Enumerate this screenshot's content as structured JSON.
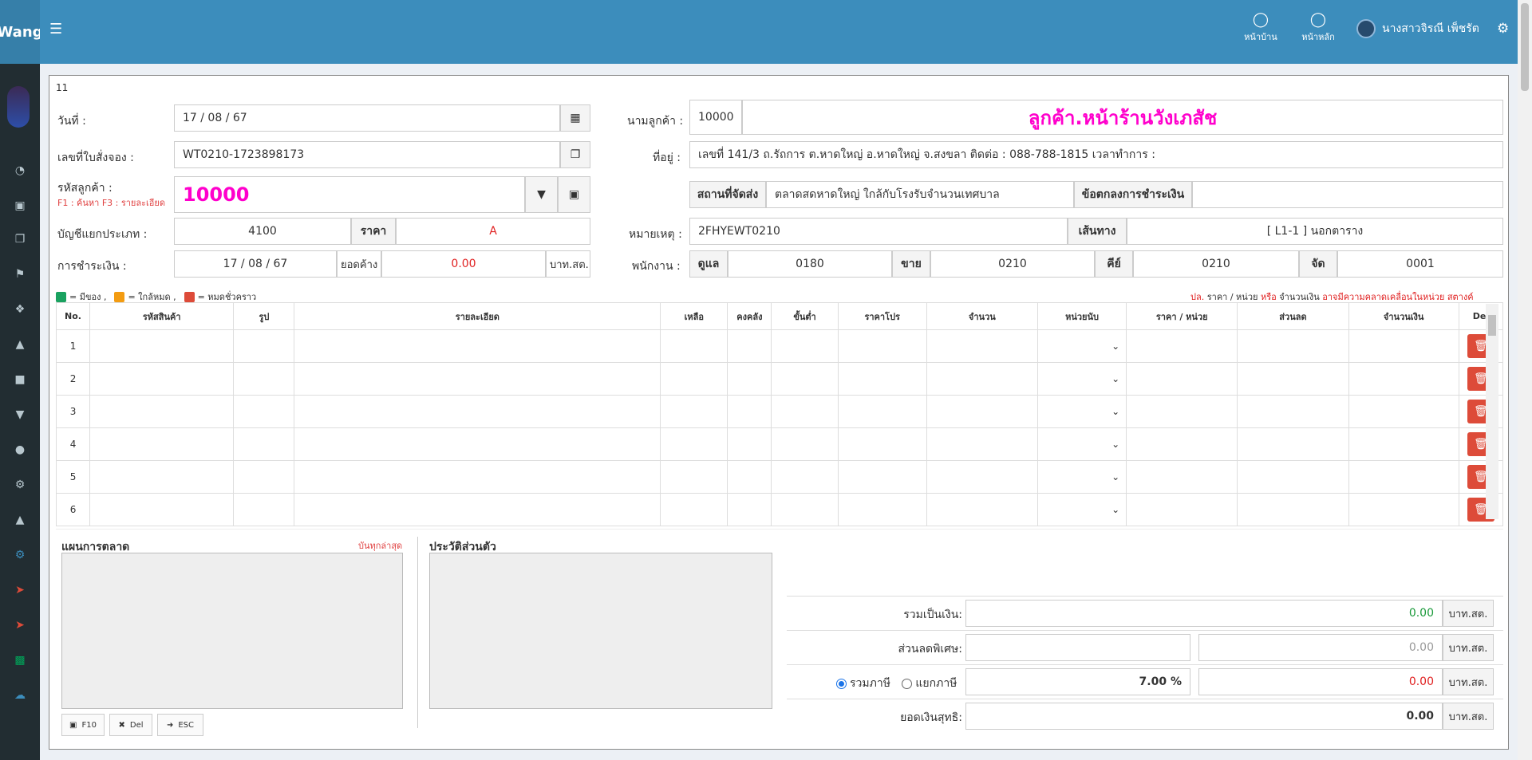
{
  "header": {
    "logo": "Wang",
    "nav": [
      {
        "label": "หน้าบ้าน",
        "icon": "chrome-icon"
      },
      {
        "label": "หน้าหลัก",
        "icon": "chrome-icon"
      }
    ],
    "user_name": "นางสาวจิรณี เพ็ชรัต"
  },
  "sidebar": {
    "icons": [
      "dashboard-icon",
      "money-icon",
      "copy-icon",
      "tag-icon",
      "cubes-icon",
      "car-icon",
      "bag-icon",
      "graduation-icon",
      "user-plus-icon",
      "cog-icon",
      "car-icon",
      "cogs-icon",
      "send-icon",
      "send-icon",
      "file-icon",
      "cloud-upload-icon"
    ]
  },
  "form": {
    "tab_number": "11",
    "date_label": "วันที่  :",
    "date_value": "17 / 08 / 67",
    "order_no_label": "เลขที่ใบสั่งจอง  :",
    "order_no_value": "WT0210-1723898173",
    "customer_code_label": "รหัสลูกค้า  :",
    "customer_code_hint": "F1 : ค้นหา   F3 : รายละเอียด",
    "customer_code_value": "10000",
    "account_label": "บัญชีแยกประเภท  :",
    "account_value": "4100",
    "price_label": "ราคา",
    "price_value": "A",
    "payment_label": "การชำระเงิน  :",
    "payment_date": "17 / 08 / 67",
    "balance_label": "ยอดค้าง",
    "balance_value": "0.00",
    "balance_unit": "บาท.สต.",
    "customer_name_label": "นามลูกค้า  :",
    "customer_id": "10000",
    "customer_name": "ลูกค้า.หน้าร้านวังเภสัช",
    "address_label": "ที่อยู่  :",
    "address_value": "เลขที่ 141/3 ถ.รัถการ ต.หาดใหญ่ อ.หาดใหญ่ จ.สงขลา   ติดต่อ  :  088-788-1815   เวลาทำการ  :",
    "delivery_label": "สถานที่จัดส่ง",
    "delivery_value": "ตลาดสดหาดใหญ่  ใกล้กับโรงรับจำนวนเทศบาล",
    "terms_label": "ข้อตกลงการชำระเงิน",
    "terms_value": "",
    "remark_label": "หมายเหตุ  :",
    "remark_value": "2FHYEWT0210",
    "route_label": "เส้นทาง",
    "route_value": "[   L1-1   ]    นอกตาราง",
    "staff_label": "พนักงาน  :",
    "staff": [
      {
        "label": "ดูแล",
        "value": "0180"
      },
      {
        "label": "ขาย",
        "value": "0210"
      },
      {
        "label": "คีย์",
        "value": "0210"
      },
      {
        "label": "จัด",
        "value": "0001"
      }
    ]
  },
  "legend": {
    "items": [
      {
        "color": "#1aa260",
        "label": "= มีของ  ,"
      },
      {
        "color": "#f39c12",
        "label": "= ใกล้หมด  ,"
      },
      {
        "color": "#dd4b39",
        "label": "= หมดชั่วคราว"
      }
    ],
    "note_1": "ปล.",
    "note_2": "ราคา / หน่วย",
    "note_3": "หรือ",
    "note_4": "จำนวนเงิน",
    "note_5": "อาจมีความคลาดเคลื่อนในหน่วย   สตางค์"
  },
  "grid": {
    "columns": [
      "No.",
      "รหัสสินค้า",
      "รูป",
      "รายละเอียด",
      "เหลือ",
      "คงคลัง",
      "ขั้นต่ำ",
      "ราคาโปร",
      "จำนวน",
      "หน่วยนับ",
      "ราคา / หน่วย",
      "ส่วนลด",
      "จำนวนเงิน",
      "Del"
    ],
    "rows": [
      "1",
      "2",
      "3",
      "4",
      "5",
      "6"
    ]
  },
  "bottom": {
    "marketing_title": "แผนการตลาด",
    "latest_link": "บันทุกล่าสุด",
    "history_title": "ประวัติส่วนตัว",
    "buttons": [
      {
        "label": "F10",
        "icon": "save-icon"
      },
      {
        "label": "Del",
        "icon": "times-icon"
      },
      {
        "label": "ESC",
        "icon": "sign-out-icon"
      }
    ]
  },
  "summary": {
    "total_label": "รวมเป็นเงิน:",
    "total_value": "0.00",
    "discount_label": "ส่วนลดพิเศษ:",
    "discount_value": "",
    "discount_amount": "0.00",
    "vat_include_label": "รวมภาษี",
    "vat_exclude_label": "แยกภาษี",
    "vat_rate": "7.00 %",
    "vat_amount": "0.00",
    "net_label": "ยอดเงินสุทธิ:",
    "net_value": "0.00",
    "unit": "บาท.สต."
  }
}
